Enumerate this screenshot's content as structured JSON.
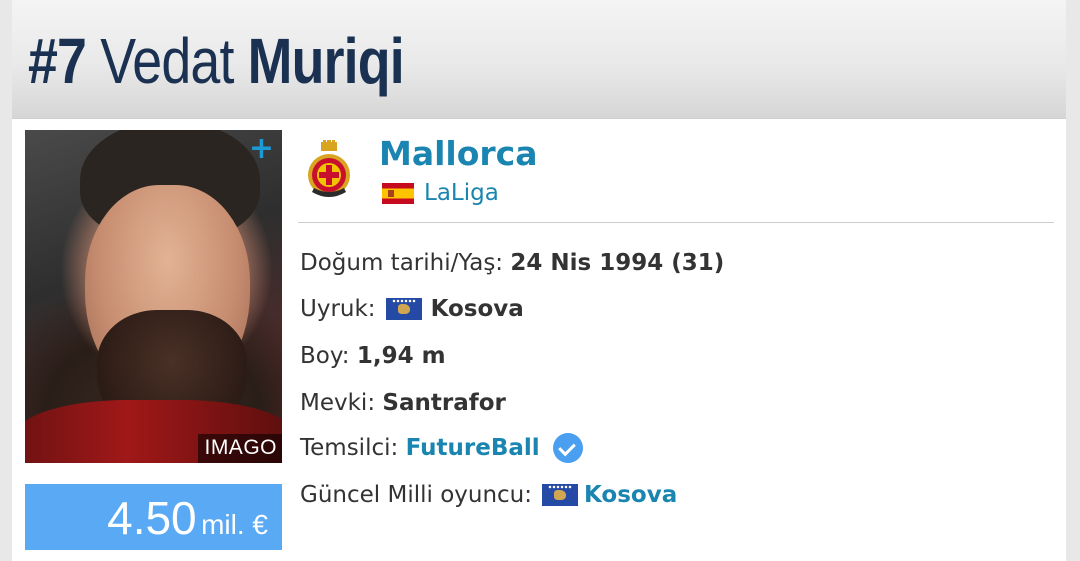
{
  "header": {
    "number": "#7",
    "first_name": "Vedat",
    "last_name": "Muriqi"
  },
  "photo": {
    "plus_icon": "+",
    "credit": "IMAGO"
  },
  "market_value": {
    "amount": "4.50",
    "unit": "mil. €"
  },
  "club": {
    "name": "Mallorca",
    "league": "LaLiga",
    "league_flag": "spain-flag-icon"
  },
  "details": {
    "birth_label": "Doğum tarihi/Yaş:",
    "birth_value": "24 Nis 1994 (31)",
    "citizenship_label": "Uyruk:",
    "citizenship_value": "Kosova",
    "height_label": "Boy:",
    "height_value": "1,94 m",
    "position_label": "Mevki:",
    "position_value": "Santrafor",
    "agent_label": "Temsilci:",
    "agent_value": "FutureBall",
    "national_label": "Güncel Milli oyuncu:",
    "national_value": "Kosova"
  },
  "colors": {
    "title": "#1a3151",
    "link": "#1a85b0",
    "value_box": "#5aa9f5",
    "plus": "#1c9ad6"
  }
}
